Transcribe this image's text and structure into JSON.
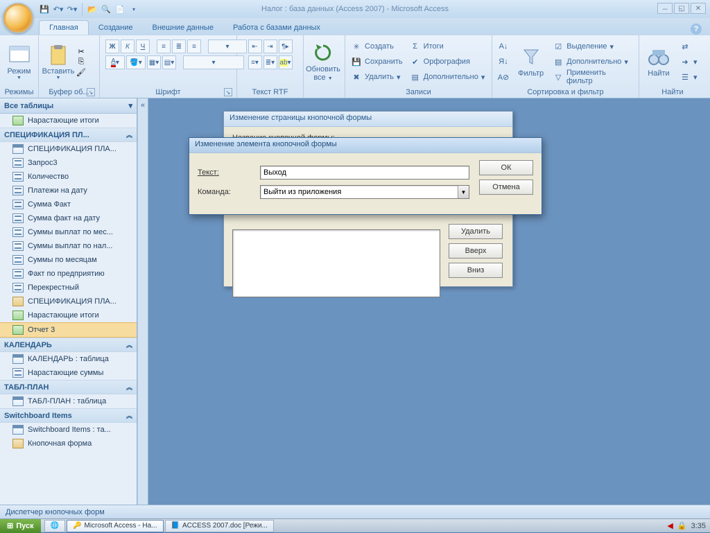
{
  "title": "Налог : база данных (Access 2007) - Microsoft Access",
  "tabs": [
    "Главная",
    "Создание",
    "Внешние данные",
    "Работа с базами данных"
  ],
  "ribbon_groups": {
    "modes": {
      "label": "Режимы",
      "btn": "Режим"
    },
    "clipboard": {
      "label": "Буфер об...",
      "btn": "Вставить"
    },
    "font": {
      "label": "Шрифт"
    },
    "rtf": {
      "label": "Текст RTF"
    },
    "refresh": {
      "label": "",
      "btn": "Обновить",
      "btn2": "все"
    },
    "records": {
      "label": "Записи",
      "create": "Создать",
      "totals": "Итоги",
      "save": "Сохранить",
      "spell": "Орфография",
      "delete": "Удалить",
      "more": "Дополнительно"
    },
    "sortfilter": {
      "label": "Сортировка и фильтр",
      "filter": "Фильтр",
      "select": "Выделение",
      "adv": "Дополнительно",
      "apply": "Применить фильтр"
    },
    "find": {
      "label": "Найти",
      "btn": "Найти"
    }
  },
  "nav": {
    "header": "Все таблицы",
    "groups": [
      {
        "title": "СПЕЦИФИКАЦИЯ ПЛ...",
        "pre": {
          "icon": "rpt",
          "label": "Нарастающие итоги"
        },
        "items": [
          {
            "icon": "tbl",
            "label": "СПЕЦИФИКАЦИЯ ПЛА..."
          },
          {
            "icon": "qry",
            "label": "Запрос3"
          },
          {
            "icon": "qry",
            "label": "Количество"
          },
          {
            "icon": "qry",
            "label": "Платежи на дату"
          },
          {
            "icon": "qry",
            "label": "Сумма Факт"
          },
          {
            "icon": "qry",
            "label": "Сумма факт на дату"
          },
          {
            "icon": "qry",
            "label": "Суммы выплат по мес..."
          },
          {
            "icon": "qry",
            "label": "Суммы выплат по нал..."
          },
          {
            "icon": "qry",
            "label": "Суммы по месяцам"
          },
          {
            "icon": "qry",
            "label": "Факт по предприятию"
          },
          {
            "icon": "qry",
            "label": "Перекрестный"
          },
          {
            "icon": "frm",
            "label": "СПЕЦИФИКАЦИЯ ПЛА..."
          },
          {
            "icon": "rpt",
            "label": "Нарастающие итоги"
          },
          {
            "icon": "rpt",
            "label": "Отчет 3",
            "sel": true
          }
        ]
      },
      {
        "title": "КАЛЕНДАРЬ",
        "items": [
          {
            "icon": "tbl",
            "label": "КАЛЕНДАРЬ : таблица"
          },
          {
            "icon": "qry",
            "label": "Нарастающие суммы"
          }
        ]
      },
      {
        "title": "ТАБЛ-ПЛАН",
        "items": [
          {
            "icon": "tbl",
            "label": "ТАБЛ-ПЛАН : таблица"
          }
        ]
      },
      {
        "title": "Switchboard Items",
        "items": [
          {
            "icon": "tbl",
            "label": "Switchboard Items : та..."
          },
          {
            "icon": "frm",
            "label": "Кнопочная форма"
          }
        ]
      }
    ]
  },
  "back_dialog": {
    "title": "Изменение страницы кнопочной формы",
    "label1": "Название кнопочной формы:",
    "buttons": {
      "delete": "Удалить",
      "up": "Вверх",
      "down": "Вниз"
    }
  },
  "front_dialog": {
    "title": "Изменение элемента кнопочной формы",
    "text_label": "Текст:",
    "text_value": "Выход",
    "cmd_label": "Команда:",
    "cmd_value": "Выйти из приложения",
    "ok": "ОК",
    "cancel": "Отмена"
  },
  "status": "Диспетчер кнопочных форм",
  "taskbar": {
    "start": "Пуск",
    "items": [
      "Microsoft Access - На...",
      "ACCESS 2007.doc [Режи..."
    ],
    "time": "3:35"
  }
}
